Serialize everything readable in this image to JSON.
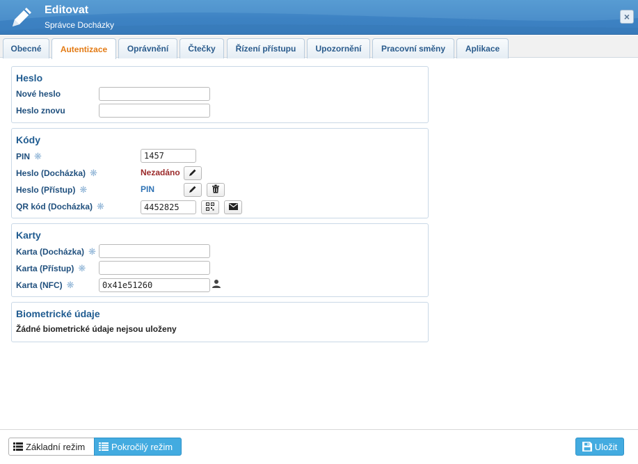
{
  "window": {
    "title": "Editovat",
    "subtitle": "Správce Docházky",
    "close_label": "×"
  },
  "tabs": [
    {
      "label": "Obecné",
      "active": false
    },
    {
      "label": "Autentizace",
      "active": true
    },
    {
      "label": "Oprávnění",
      "active": false
    },
    {
      "label": "Čtečky",
      "active": false
    },
    {
      "label": "Řízení přístupu",
      "active": false
    },
    {
      "label": "Upozornění",
      "active": false
    },
    {
      "label": "Pracovní směny",
      "active": false
    },
    {
      "label": "Aplikace",
      "active": false
    }
  ],
  "heslo": {
    "title": "Heslo",
    "new_password_label": "Nové heslo",
    "new_password_value": "",
    "repeat_label": "Heslo znovu",
    "repeat_value": ""
  },
  "kody": {
    "title": "Kódy",
    "pin_label": "PIN",
    "pin_value": "1457",
    "heslo_dochazka_label": "Heslo (Docházka)",
    "heslo_dochazka_value": "Nezadáno",
    "heslo_pristup_label": "Heslo (Přístup)",
    "heslo_pristup_value": "PIN",
    "qr_label": "QR kód (Docházka)",
    "qr_value": "4452825"
  },
  "karty": {
    "title": "Karty",
    "karta_dochazka_label": "Karta (Docházka)",
    "karta_dochazka_value": "",
    "karta_pristup_label": "Karta (Přístup)",
    "karta_pristup_value": "",
    "karta_nfc_label": "Karta (NFC)",
    "karta_nfc_value": "0x41e51260"
  },
  "biometrie": {
    "title": "Biometrické údaje",
    "empty_text": "Žádné biometrické údaje nejsou uloženy"
  },
  "footer": {
    "basic_mode_label": "Základní režim",
    "advanced_mode_label": "Pokročilý režim",
    "save_label": "Uložit"
  },
  "required_marker": "❋",
  "colors": {
    "accent": "#43abe0",
    "title_bar": "#3d82c3",
    "active_tab_text": "#e37b15",
    "label_text": "#1f4f7d",
    "not_set": "#9b2a2a"
  },
  "icons": {
    "title": "pencil-icon",
    "edit": "pencil-icon",
    "delete": "trash-icon",
    "qr": "qr-code-icon",
    "mail": "envelope-icon",
    "user": "user-icon",
    "basic_mode": "list-icon",
    "advanced_mode": "list-icon",
    "save": "floppy-disk-icon"
  }
}
